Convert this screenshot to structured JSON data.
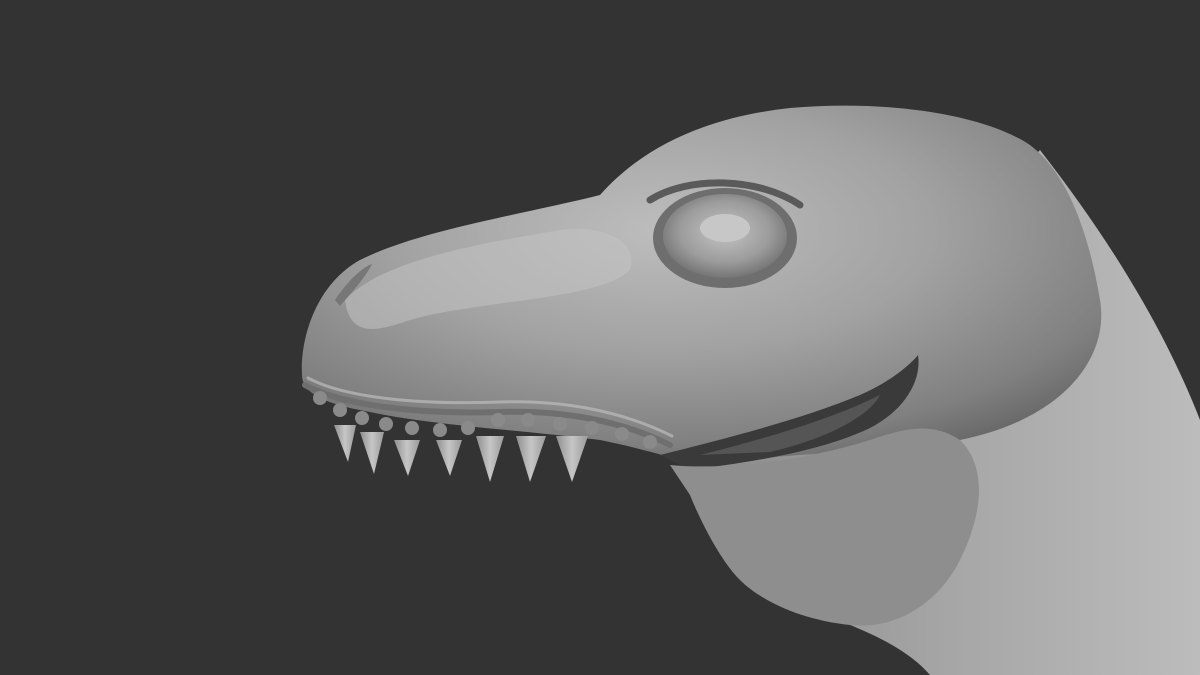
{
  "scene": {
    "background_color": "#333333",
    "model_base_color": "#9a9a9a",
    "model_highlight_color": "#c8c8c8",
    "model_shadow_color": "#3a3a3a",
    "teeth_color": "#b4b4b4",
    "subject": "dinosaur-head-sculpt"
  }
}
